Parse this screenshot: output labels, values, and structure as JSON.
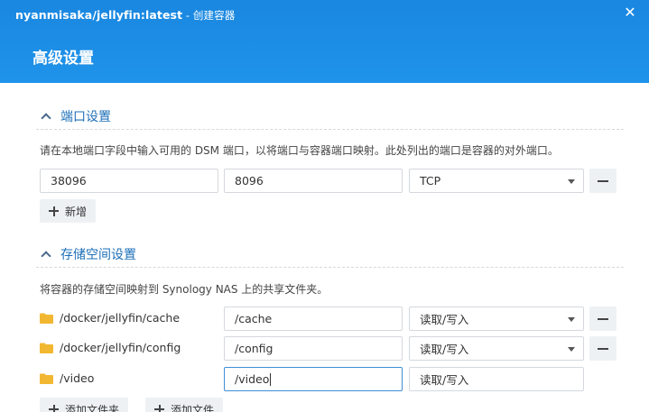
{
  "window": {
    "title": "nyanmisaka/jellyfin:latest",
    "subtitle": " - 创建容器",
    "close_glyph": "✕"
  },
  "page": {
    "heading": "高级设置"
  },
  "ports_section": {
    "title": "端口设置",
    "description": "请在本地端口字段中输入可用的 DSM 端口，以将端口与容器端口映射。此处列出的端口是容器的对外端口。",
    "rows": [
      {
        "local_port": "38096",
        "container_port": "8096",
        "protocol": "TCP"
      }
    ],
    "add_label": "新增"
  },
  "storage_section": {
    "title": "存储空间设置",
    "description": "将容器的存储空间映射到 Synology NAS 上的共享文件夹。",
    "rows": [
      {
        "folder": "/docker/jellyfin/cache",
        "mount_path": "/cache",
        "permission": "读取/写入"
      },
      {
        "folder": "/docker/jellyfin/config",
        "mount_path": "/config",
        "permission": "读取/写入"
      },
      {
        "folder": "/video",
        "mount_path": "/video",
        "permission": "读取/写入"
      }
    ],
    "add_folder_label": "添加文件夹",
    "add_file_label": "添加文件"
  },
  "colors": {
    "header_bg": "#1f8fe6",
    "section_title": "#1d6fb8",
    "folder_icon": "#f2b731",
    "button_bg": "#eef1f4"
  }
}
